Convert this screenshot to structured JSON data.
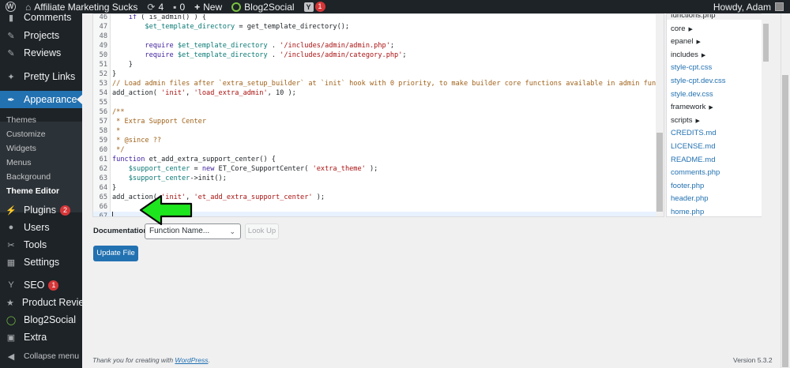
{
  "adminbar": {
    "site_name": "Affiliate Marketing Sucks",
    "updates_count": "4",
    "comments_count": "0",
    "new_label": "New",
    "b2s_label": "Blog2Social",
    "yoast_badge": "1",
    "howdy": "Howdy, Adam"
  },
  "sidebar": {
    "comments": "Comments",
    "projects": "Projects",
    "reviews": "Reviews",
    "pretty_links": "Pretty Links",
    "appearance": "Appearance",
    "submenu": [
      "Themes",
      "Customize",
      "Widgets",
      "Menus",
      "Background",
      "Theme Editor"
    ],
    "plugins": "Plugins",
    "plugins_badge": "2",
    "users": "Users",
    "tools": "Tools",
    "settings": "Settings",
    "seo": "SEO",
    "seo_badge": "1",
    "product_review": "Product Review",
    "blog2social": "Blog2Social",
    "extra": "Extra",
    "collapse": "Collapse menu"
  },
  "editor": {
    "lines": [
      {
        "n": "46",
        "html": "    <span class=\"kw\">if</span> ( is_admin() ) {"
      },
      {
        "n": "47",
        "html": "        <span class=\"var\">$et_template_directory</span> = get_template_directory();"
      },
      {
        "n": "48",
        "html": ""
      },
      {
        "n": "49",
        "html": "        <span class=\"kw\">require</span> <span class=\"var\">$et_template_directory</span> . <span class=\"str\">'/includes/admin/admin.php'</span>;"
      },
      {
        "n": "50",
        "html": "        <span class=\"kw\">require</span> <span class=\"var\">$et_template_directory</span> . <span class=\"str\">'/includes/admin/category.php'</span>;"
      },
      {
        "n": "51",
        "html": "    }"
      },
      {
        "n": "52",
        "html": "}"
      },
      {
        "n": "53",
        "html": "<span class=\"cm\">// Load admin files after `extra_setup_builder` at `init` hook with 0 priority, to make builder core functions available in admin functions.</span>"
      },
      {
        "n": "54",
        "html": "add_action( <span class=\"str\">'init'</span>, <span class=\"str\">'load_extra_admin'</span>, 10 );"
      },
      {
        "n": "55",
        "html": ""
      },
      {
        "n": "56",
        "html": "<span class=\"cm\">/**</span>"
      },
      {
        "n": "57",
        "html": "<span class=\"cm\"> * Extra Support Center</span>"
      },
      {
        "n": "58",
        "html": "<span class=\"cm\"> *</span>"
      },
      {
        "n": "59",
        "html": "<span class=\"cm\"> * @since ??</span>"
      },
      {
        "n": "60",
        "html": "<span class=\"cm\"> */</span>"
      },
      {
        "n": "61",
        "html": "<span class=\"kw\">function</span> et_add_extra_support_center() {"
      },
      {
        "n": "62",
        "html": "    <span class=\"var\">$support_center</span> = <span class=\"kw\">new</span> ET_Core_SupportCenter( <span class=\"str\">'extra_theme'</span> );"
      },
      {
        "n": "63",
        "html": "    <span class=\"var\">$support_center</span>-&gt;init();"
      },
      {
        "n": "64",
        "html": "}"
      },
      {
        "n": "65",
        "html": "add_action( <span class=\"str\">'init'</span>, <span class=\"str\">'et_add_extra_support_center'</span> );"
      },
      {
        "n": "66",
        "html": ""
      },
      {
        "n": "67",
        "html": "<span class=\"caret\"></span>"
      }
    ],
    "active_line": "67"
  },
  "files": [
    {
      "name": "functions.php",
      "type": "current"
    },
    {
      "name": "core",
      "type": "folder"
    },
    {
      "name": "epanel",
      "type": "folder"
    },
    {
      "name": "includes",
      "type": "folder"
    },
    {
      "name": "style-cpt.css",
      "type": "file"
    },
    {
      "name": "style-cpt.dev.css",
      "type": "file"
    },
    {
      "name": "style.dev.css",
      "type": "file"
    },
    {
      "name": "framework",
      "type": "folder"
    },
    {
      "name": "scripts",
      "type": "folder"
    },
    {
      "name": "CREDITS.md",
      "type": "file"
    },
    {
      "name": "LICENSE.md",
      "type": "file"
    },
    {
      "name": "README.md",
      "type": "file"
    },
    {
      "name": "comments.php",
      "type": "file"
    },
    {
      "name": "footer.php",
      "type": "file"
    },
    {
      "name": "header.php",
      "type": "file"
    },
    {
      "name": "home.php",
      "type": "file"
    }
  ],
  "documentation": {
    "label": "Documentation:",
    "select_value": "Function Name...",
    "lookup_label": "Look Up"
  },
  "update_button": "Update File",
  "footer": {
    "thanks_prefix": "Thank you for creating with ",
    "wp_link": "WordPress",
    "thanks_suffix": ".",
    "version": "Version 5.3.2"
  },
  "colors": {
    "accent": "#2271b1",
    "sidebar_bg": "#1d2327",
    "arrow_green": "#1ee61e"
  }
}
